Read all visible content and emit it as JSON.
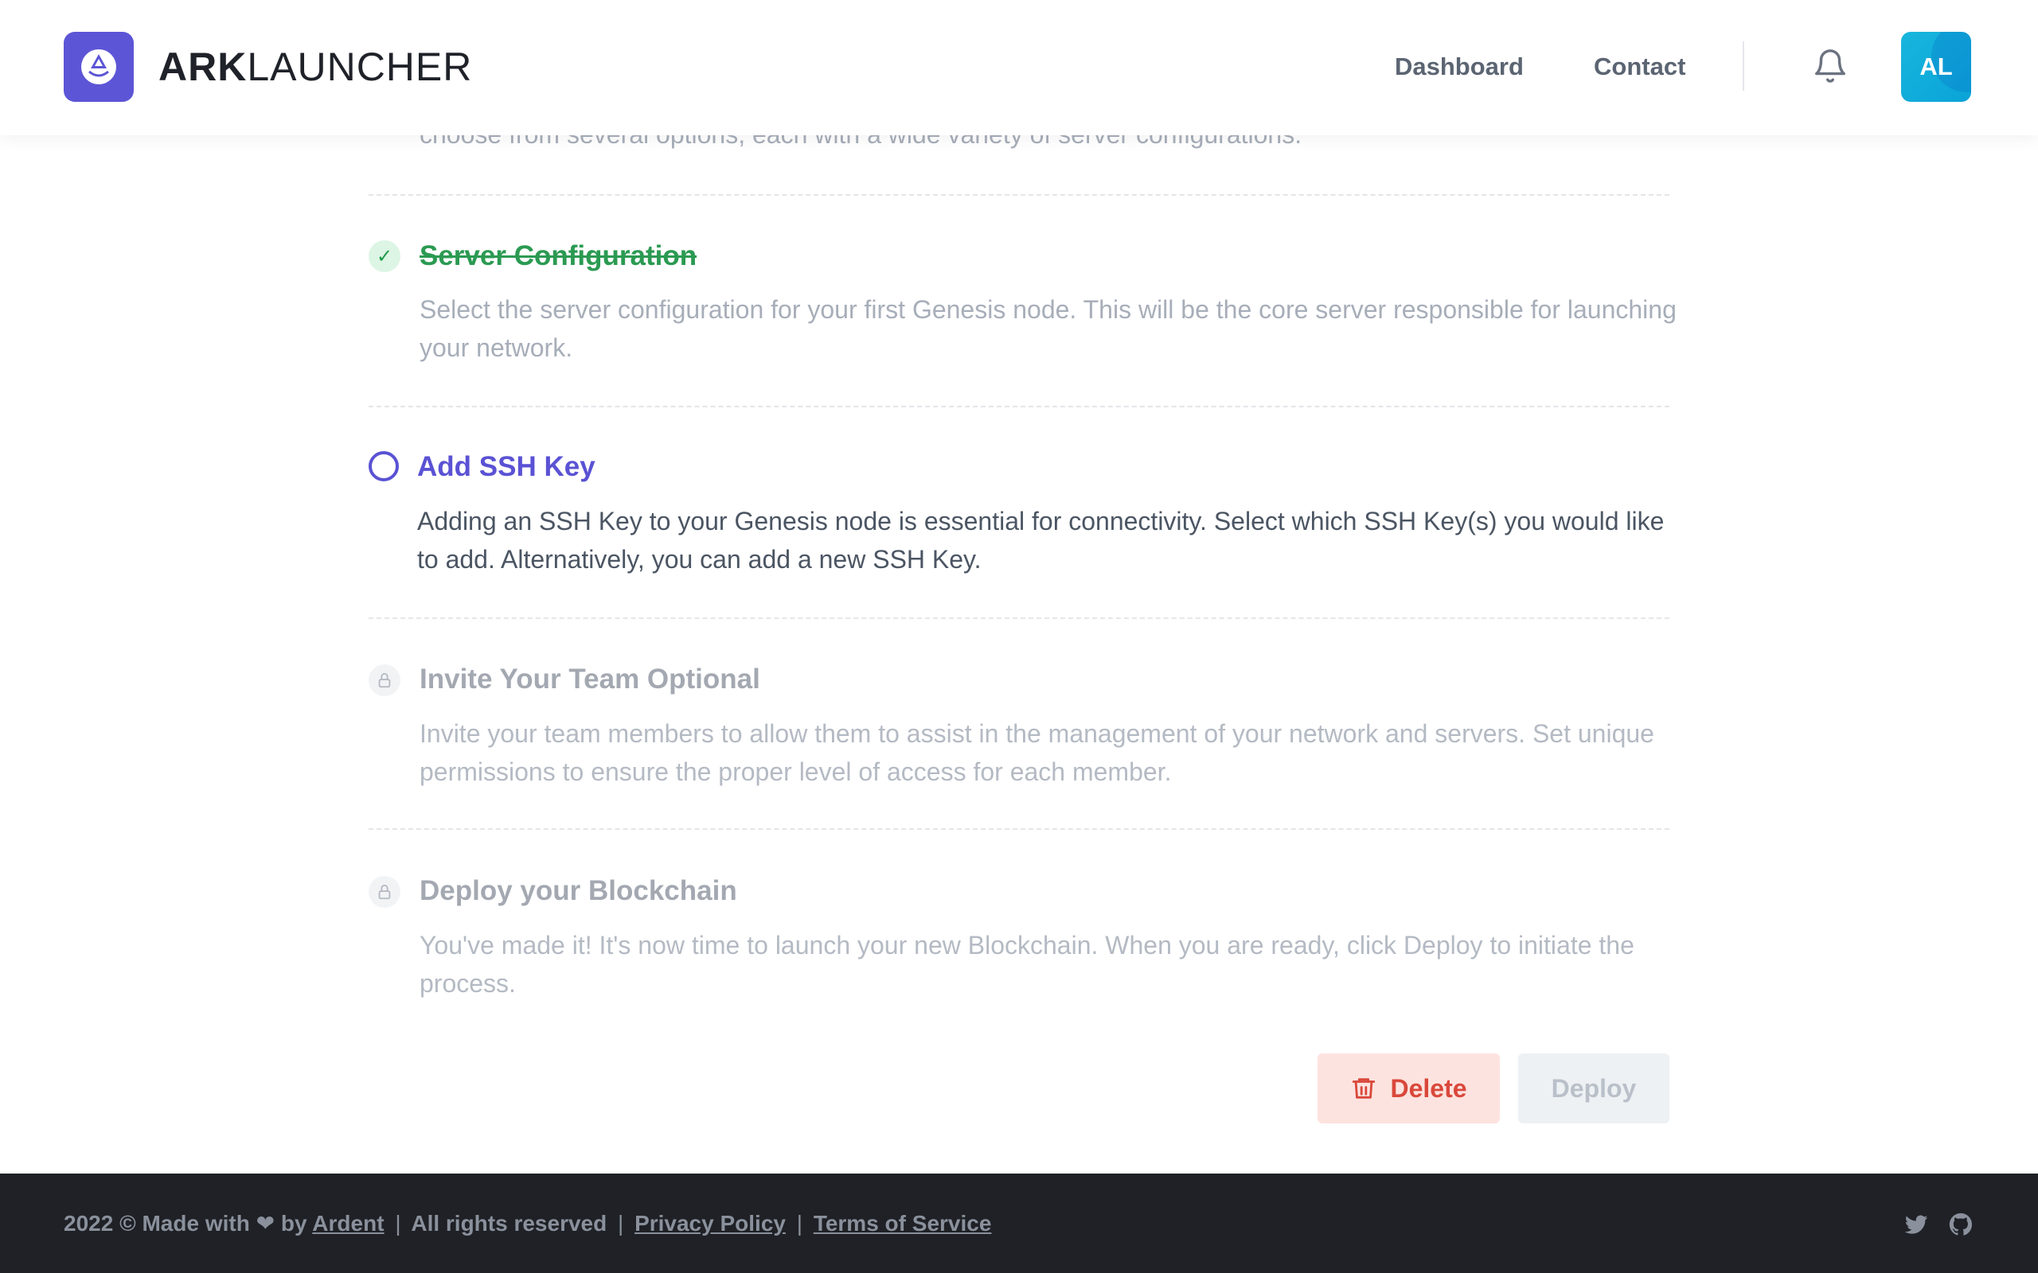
{
  "header": {
    "brand_bold": "ARK",
    "brand_light": "LAUNCHER",
    "logo_icon": "ark-logo-icon",
    "nav": [
      {
        "label": "Dashboard"
      },
      {
        "label": "Contact"
      }
    ],
    "notification_icon": "bell-icon",
    "avatar_initials": "AL"
  },
  "steps": {
    "partial_description": "choose from several options, each with a wide variety of server configurations.",
    "items": [
      {
        "title": "Server Configuration",
        "description": "Select the server configuration for your first Genesis node. This will be the core server responsible for launching your network.",
        "status": "completed",
        "icon": "check-icon",
        "icon_glyph": "✓"
      },
      {
        "title": "Add SSH Key",
        "description": "Adding an SSH Key to your Genesis node is essential for connectivity. Select which SSH Key(s) you would like to add. Alternatively, you can add a new SSH Key.",
        "status": "current",
        "icon": "circle-icon"
      },
      {
        "title": "Invite Your Team Optional",
        "description": "Invite your team members to allow them to assist in the management of your network and servers. Set unique permissions to ensure the proper level of access for each member.",
        "status": "locked",
        "icon": "lock-icon"
      },
      {
        "title": "Deploy your Blockchain",
        "description": "You've made it! It's now time to launch your new Blockchain. When you are ready, click Deploy to initiate the process.",
        "status": "locked",
        "icon": "lock-icon"
      }
    ]
  },
  "actions": {
    "delete_label": "Delete",
    "deploy_label": "Deploy"
  },
  "footer": {
    "year_text": "2022 © Made with",
    "heart": "❤",
    "by_text": "by",
    "author_link": "Ardent",
    "rights_text": "All rights reserved",
    "privacy_link": "Privacy Policy",
    "terms_link": "Terms of Service",
    "separator": "|"
  },
  "colors": {
    "brand_primary": "#5c55d6",
    "completed_green": "#2b9a52",
    "current_purple": "#5a52d4",
    "delete_red": "#d9483b",
    "avatar_cyan": "#17b6dd",
    "footer_bg": "#1f2126"
  }
}
